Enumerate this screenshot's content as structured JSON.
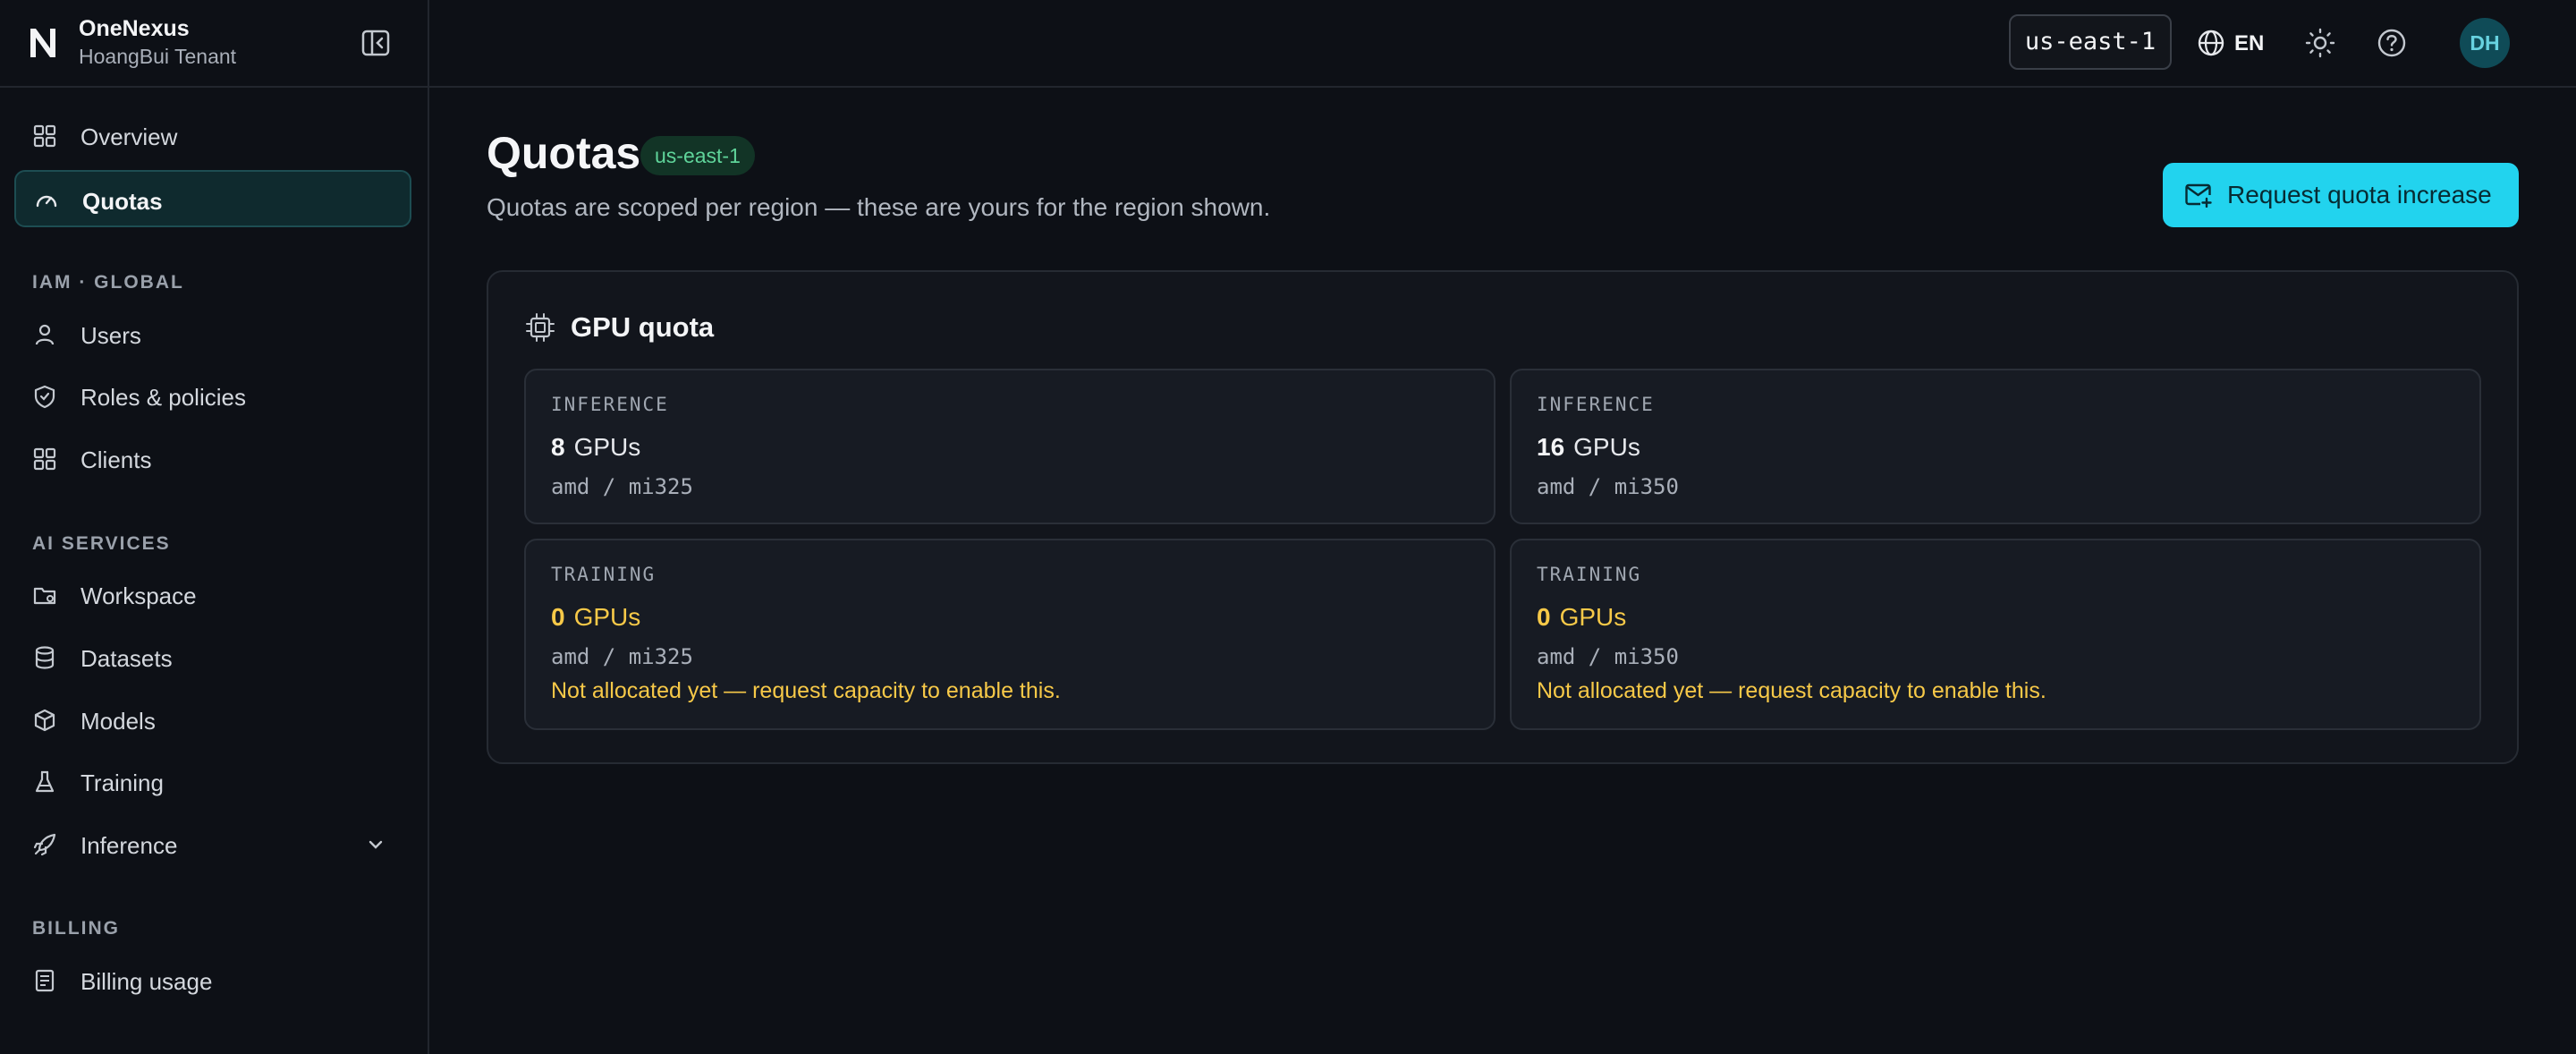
{
  "brand": {
    "name": "OneNexus",
    "tenant": "HoangBui Tenant"
  },
  "sidebar": {
    "top_items": [
      {
        "label": "Overview",
        "icon": "grid-icon",
        "active": false
      },
      {
        "label": "Quotas",
        "icon": "gauge-icon",
        "active": true
      }
    ],
    "sections": [
      {
        "title": "IAM · GLOBAL",
        "items": [
          {
            "label": "Users",
            "icon": "user-icon"
          },
          {
            "label": "Roles & policies",
            "icon": "shield-icon"
          },
          {
            "label": "Clients",
            "icon": "grid-icon"
          }
        ]
      },
      {
        "title": "AI SERVICES",
        "items": [
          {
            "label": "Workspace",
            "icon": "folder-icon"
          },
          {
            "label": "Datasets",
            "icon": "database-icon"
          },
          {
            "label": "Models",
            "icon": "cube-icon"
          },
          {
            "label": "Training",
            "icon": "flask-icon"
          },
          {
            "label": "Inference",
            "icon": "rocket-icon",
            "expandable": true
          }
        ]
      },
      {
        "title": "BILLING",
        "items": [
          {
            "label": "Billing usage",
            "icon": "receipt-icon"
          }
        ]
      }
    ]
  },
  "topbar": {
    "region": "us-east-1",
    "language": "EN",
    "avatar_initials": "DH"
  },
  "page": {
    "title": "Quotas",
    "region_badge": "us-east-1",
    "subtitle": "Quotas are scoped per region — these are yours for the region shown.",
    "request_button": "Request quota increase"
  },
  "gpu_quota": {
    "title": "GPU quota",
    "quotas": [
      {
        "kind": "INFERENCE",
        "count": "8",
        "unit": "GPUs",
        "model": "amd / mi325",
        "note": ""
      },
      {
        "kind": "INFERENCE",
        "count": "16",
        "unit": "GPUs",
        "model": "amd / mi350",
        "note": ""
      },
      {
        "kind": "TRAINING",
        "count": "0",
        "unit": "GPUs",
        "model": "amd / mi325",
        "note": "Not allocated yet — request capacity to enable this."
      },
      {
        "kind": "TRAINING",
        "count": "0",
        "unit": "GPUs",
        "model": "amd / mi350",
        "note": "Not allocated yet — request capacity to enable this."
      }
    ]
  },
  "colors": {
    "accent": "#22d3ee",
    "badge_green": "#5fd49a",
    "warning": "#f7c948",
    "background": "#0d1016"
  }
}
